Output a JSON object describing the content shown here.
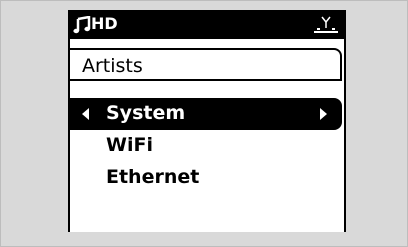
{
  "status_bar": {
    "source": "HD",
    "source_icon": "music-note-icon",
    "signal_icon": "antenna-signal-icon"
  },
  "screen": {
    "title": "Artists"
  },
  "menu": {
    "items": [
      {
        "label": "System",
        "selected": true
      },
      {
        "label": "WiFi",
        "selected": false
      },
      {
        "label": "Ethernet",
        "selected": false
      }
    ]
  },
  "colors": {
    "background": "#d9d9d9",
    "screen": "#ffffff",
    "highlight": "#000000"
  }
}
